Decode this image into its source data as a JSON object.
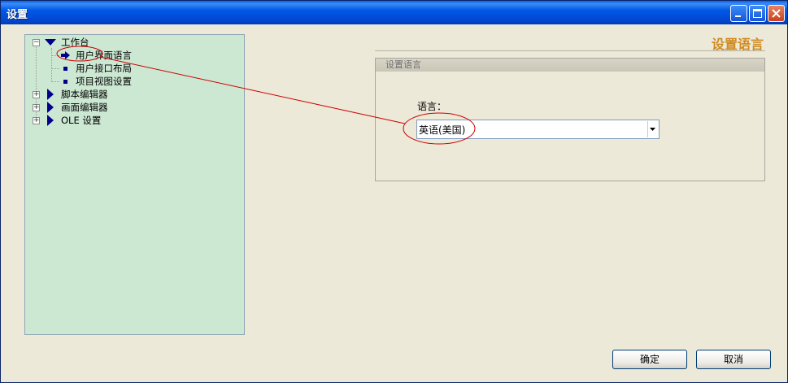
{
  "window": {
    "title": "设置"
  },
  "tree": {
    "root_label": "工作台",
    "children": [
      "用户界面语言",
      "用户接口布局",
      "项目视图设置"
    ],
    "others": [
      "脚本编辑器",
      "画面编辑器",
      "OLE 设置"
    ]
  },
  "content": {
    "heading": "设置语言",
    "group_title": "设置语言",
    "language_label": "语言：",
    "language_value": "英语(美国)"
  },
  "buttons": {
    "ok": "确定",
    "cancel": "取消"
  },
  "colors": {
    "tree_bg": "#CCE8D3",
    "heading": "#D08A1F",
    "annotation": "#CC0000",
    "titlebar": "#0054E3"
  }
}
